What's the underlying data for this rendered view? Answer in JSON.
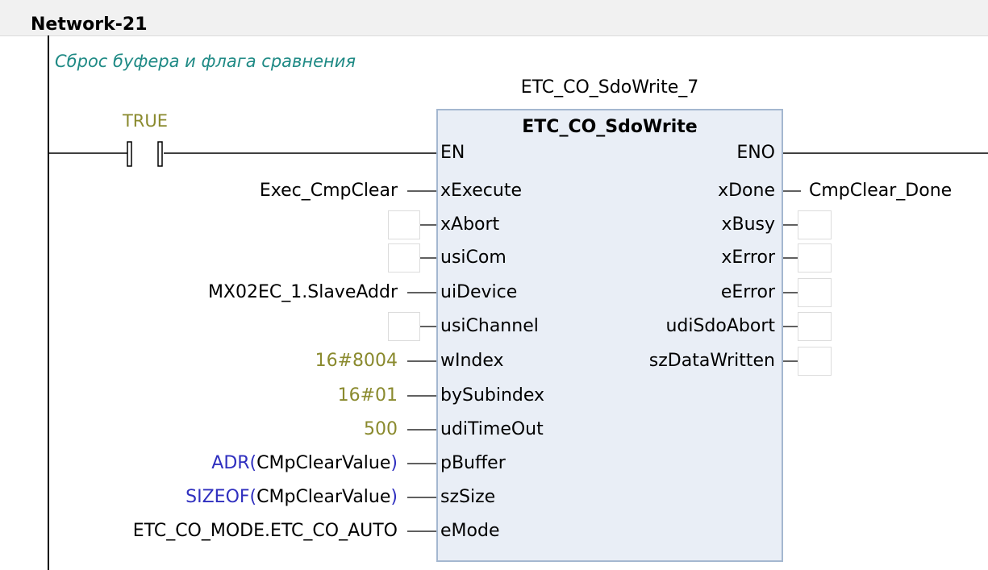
{
  "network": {
    "title": "Network-21",
    "comment": "Сброс буфера и флага сравнения"
  },
  "contact": {
    "label": "TRUE"
  },
  "function_block": {
    "instance": "ETC_CO_SdoWrite_7",
    "type": "ETC_CO_SdoWrite",
    "inputs": [
      {
        "pin": "EN",
        "arg": ""
      },
      {
        "pin": "xExecute",
        "arg": "Exec_CmpClear"
      },
      {
        "pin": "xAbort",
        "arg": ""
      },
      {
        "pin": "usiCom",
        "arg": ""
      },
      {
        "pin": "uiDevice",
        "arg": "MX02EC_1.SlaveAddr"
      },
      {
        "pin": "usiChannel",
        "arg": ""
      },
      {
        "pin": "wIndex",
        "arg": "16#8004"
      },
      {
        "pin": "bySubindex",
        "arg": "16#01"
      },
      {
        "pin": "udiTimeOut",
        "arg": "500"
      },
      {
        "pin": "pBuffer",
        "arg_op": "ADR",
        "arg_open": "(",
        "arg_inner": "CMpClearValue",
        "arg_close": ")"
      },
      {
        "pin": "szSize",
        "arg_op": "SIZEOF",
        "arg_open": "(",
        "arg_inner": "CMpClearValue",
        "arg_close": ")"
      },
      {
        "pin": "eMode",
        "arg": "ETC_CO_MODE.ETC_CO_AUTO"
      }
    ],
    "outputs": [
      {
        "pin": "ENO",
        "var": ""
      },
      {
        "pin": "xDone",
        "var": "CmpClear_Done"
      },
      {
        "pin": "xBusy",
        "var": ""
      },
      {
        "pin": "xError",
        "var": ""
      },
      {
        "pin": "eError",
        "var": ""
      },
      {
        "pin": "udiSdoAbort",
        "var": ""
      },
      {
        "pin": "szDataWritten",
        "var": ""
      }
    ]
  },
  "colors": {
    "comment": "#1f8a85",
    "literal": "#8a8a2e",
    "operator": "#2f2fbf",
    "block_fill": "#e9eef6",
    "block_border": "#a4b7d0"
  }
}
